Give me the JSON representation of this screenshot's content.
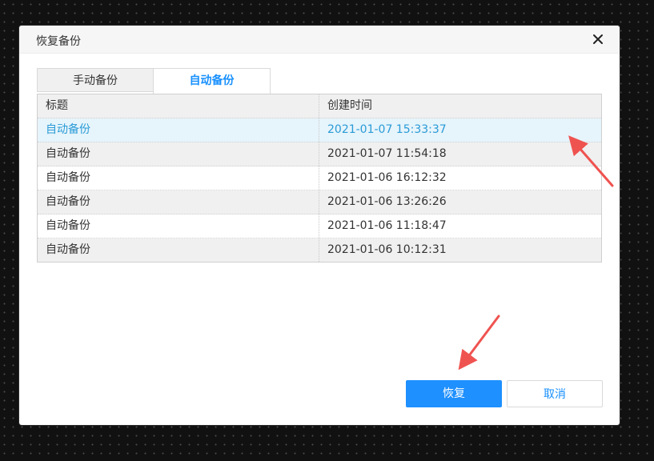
{
  "dialog": {
    "title": "恢复备份",
    "close_label": "×"
  },
  "tabs": [
    {
      "label": "手动备份",
      "active": false
    },
    {
      "label": "自动备份",
      "active": true
    }
  ],
  "table": {
    "headers": [
      "标题",
      "创建时间"
    ],
    "rows": [
      {
        "title": "自动备份",
        "created": "2021-01-07 15:33:37",
        "selected": true
      },
      {
        "title": "自动备份",
        "created": "2021-01-07 11:54:18",
        "selected": false
      },
      {
        "title": "自动备份",
        "created": "2021-01-06 16:12:32",
        "selected": false
      },
      {
        "title": "自动备份",
        "created": "2021-01-06 13:26:26",
        "selected": false
      },
      {
        "title": "自动备份",
        "created": "2021-01-06 11:18:47",
        "selected": false
      },
      {
        "title": "自动备份",
        "created": "2021-01-06 10:12:31",
        "selected": false
      }
    ]
  },
  "buttons": {
    "restore_label": "恢复",
    "cancel_label": "取消"
  },
  "colors": {
    "accent": "#1890ff",
    "selected_text": "#2a9bd7",
    "selected_row_bg": "#e6f4fb",
    "annotation_arrow": "#ef5350"
  }
}
